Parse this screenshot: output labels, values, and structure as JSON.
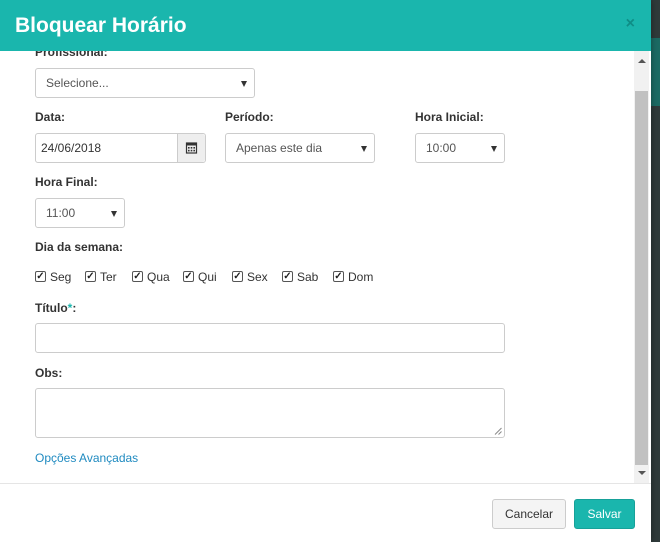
{
  "colors": {
    "header": "#1ab6ad",
    "link": "#1f8ac0",
    "save_button": "#1ab6ad"
  },
  "modal": {
    "title": "Bloquear Horário",
    "close_icon": "close-icon"
  },
  "form": {
    "profissional": {
      "label": "Profissional:",
      "value": "Selecione..."
    },
    "data": {
      "label": "Data:",
      "value": "24/06/2018",
      "icon": "calendar-icon"
    },
    "periodo": {
      "label": "Período:",
      "value": "Apenas este dia"
    },
    "hora_inicial": {
      "label": "Hora Inicial:",
      "value": "10:00"
    },
    "hora_final": {
      "label": "Hora Final:",
      "value": "11:00"
    },
    "dia_semana": {
      "label": "Dia da semana:",
      "days": [
        {
          "label": "Seg",
          "checked": true
        },
        {
          "label": "Ter",
          "checked": true
        },
        {
          "label": "Qua",
          "checked": true
        },
        {
          "label": "Qui",
          "checked": true
        },
        {
          "label": "Sex",
          "checked": true
        },
        {
          "label": "Sab",
          "checked": true
        },
        {
          "label": "Dom",
          "checked": true
        }
      ]
    },
    "titulo": {
      "label": "Título",
      "required_mark": "*",
      "colon": ":",
      "value": ""
    },
    "obs": {
      "label": "Obs:",
      "value": ""
    },
    "advanced_link": "Opções Avançadas"
  },
  "footer": {
    "cancel_label": "Cancelar",
    "save_label": "Salvar"
  }
}
